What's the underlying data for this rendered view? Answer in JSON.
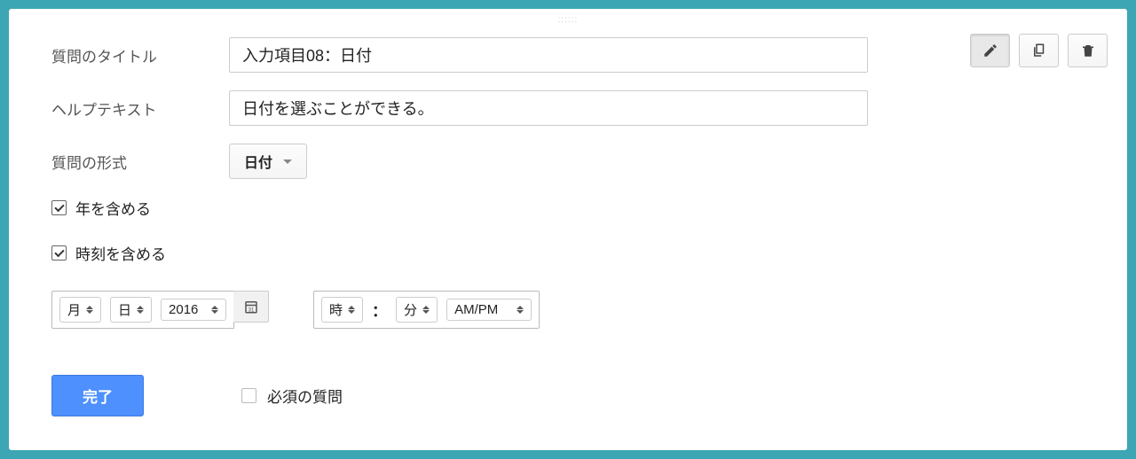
{
  "labels": {
    "title": "質問のタイトル",
    "help": "ヘルプテキスト",
    "type": "質問の形式",
    "include_year": "年を含める",
    "include_time": "時刻を含める",
    "month": "月",
    "day": "日",
    "year": "2016",
    "hour": "時",
    "minute": "分",
    "ampm": "AM/PM",
    "colon": "：",
    "done": "完了",
    "required": "必須の質問"
  },
  "values": {
    "title_input": "入力項目08：日付",
    "help_input": "日付を選ぶことができる。",
    "type_selected": "日付"
  },
  "drag_handle": "::::::"
}
